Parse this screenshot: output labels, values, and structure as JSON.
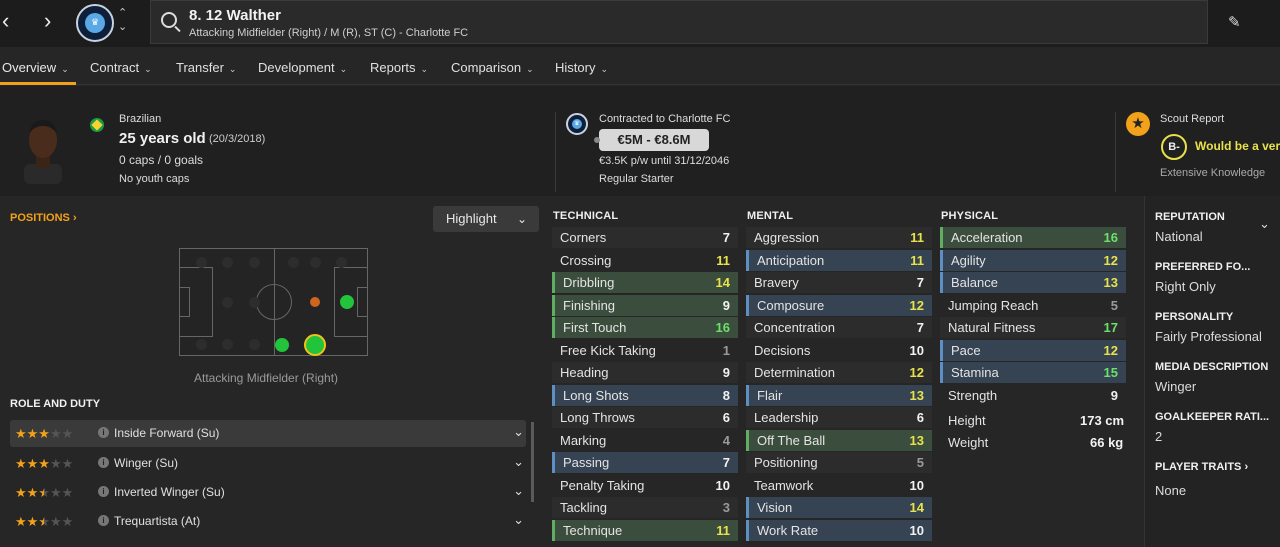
{
  "header": {
    "player_name": "8. 12 Walther",
    "player_sub": "Attacking Midfielder (Right) / M (R), ST (C) - Charlotte FC",
    "nav_back": "‹",
    "nav_forward": "›"
  },
  "tabs": [
    {
      "label": "Overview"
    },
    {
      "label": "Contract"
    },
    {
      "label": "Transfer"
    },
    {
      "label": "Development"
    },
    {
      "label": "Reports"
    },
    {
      "label": "Comparison"
    },
    {
      "label": "History"
    }
  ],
  "profile": {
    "nationality": "Brazilian",
    "age": "25 years old",
    "dob": "(20/3/2018)",
    "caps": "0 caps / 0 goals",
    "youth_caps": "No youth caps"
  },
  "contract": {
    "title": "Contracted to Charlotte FC",
    "value": "€5M - €8.6M",
    "wage": "€3.5K p/w until 31/12/2046",
    "status": "Regular Starter"
  },
  "scout": {
    "title": "Scout Report",
    "grade": "B-",
    "summary": "Would be a ver",
    "knowledge": "Extensive Knowledge"
  },
  "positions": {
    "title": "POSITIONS",
    "highlight_label": "Highlight",
    "caption": "Attacking Midfielder (Right)"
  },
  "roles": {
    "title": "ROLE AND DUTY",
    "items": [
      {
        "name": "Inside Forward (Su)",
        "rating": 3
      },
      {
        "name": "Winger (Su)",
        "rating": 3
      },
      {
        "name": "Inverted Winger (Su)",
        "rating": 2.5
      },
      {
        "name": "Trequartista (At)",
        "rating": 2.5
      }
    ]
  },
  "attributes": {
    "technical": {
      "title": "TECHNICAL",
      "items": [
        {
          "name": "Corners",
          "value": "7",
          "hl": ""
        },
        {
          "name": "Crossing",
          "value": "11",
          "hl": ""
        },
        {
          "name": "Dribbling",
          "value": "14",
          "hl": "g"
        },
        {
          "name": "Finishing",
          "value": "9",
          "hl": "g"
        },
        {
          "name": "First Touch",
          "value": "16",
          "hl": "g"
        },
        {
          "name": "Free Kick Taking",
          "value": "1",
          "hl": ""
        },
        {
          "name": "Heading",
          "value": "9",
          "hl": ""
        },
        {
          "name": "Long Shots",
          "value": "8",
          "hl": "b"
        },
        {
          "name": "Long Throws",
          "value": "6",
          "hl": ""
        },
        {
          "name": "Marking",
          "value": "4",
          "hl": ""
        },
        {
          "name": "Passing",
          "value": "7",
          "hl": "b"
        },
        {
          "name": "Penalty Taking",
          "value": "10",
          "hl": ""
        },
        {
          "name": "Tackling",
          "value": "3",
          "hl": ""
        },
        {
          "name": "Technique",
          "value": "11",
          "hl": "g"
        }
      ]
    },
    "mental": {
      "title": "MENTAL",
      "items": [
        {
          "name": "Aggression",
          "value": "11",
          "hl": ""
        },
        {
          "name": "Anticipation",
          "value": "11",
          "hl": "b"
        },
        {
          "name": "Bravery",
          "value": "7",
          "hl": ""
        },
        {
          "name": "Composure",
          "value": "12",
          "hl": "b"
        },
        {
          "name": "Concentration",
          "value": "7",
          "hl": ""
        },
        {
          "name": "Decisions",
          "value": "10",
          "hl": ""
        },
        {
          "name": "Determination",
          "value": "12",
          "hl": ""
        },
        {
          "name": "Flair",
          "value": "13",
          "hl": "b"
        },
        {
          "name": "Leadership",
          "value": "6",
          "hl": ""
        },
        {
          "name": "Off The Ball",
          "value": "13",
          "hl": "g"
        },
        {
          "name": "Positioning",
          "value": "5",
          "hl": ""
        },
        {
          "name": "Teamwork",
          "value": "10",
          "hl": ""
        },
        {
          "name": "Vision",
          "value": "14",
          "hl": "b"
        },
        {
          "name": "Work Rate",
          "value": "10",
          "hl": "b"
        }
      ]
    },
    "physical": {
      "title": "PHYSICAL",
      "items": [
        {
          "name": "Acceleration",
          "value": "16",
          "hl": "g"
        },
        {
          "name": "Agility",
          "value": "12",
          "hl": "b"
        },
        {
          "name": "Balance",
          "value": "13",
          "hl": "b"
        },
        {
          "name": "Jumping Reach",
          "value": "5",
          "hl": ""
        },
        {
          "name": "Natural Fitness",
          "value": "17",
          "hl": ""
        },
        {
          "name": "Pace",
          "value": "12",
          "hl": "b"
        },
        {
          "name": "Stamina",
          "value": "15",
          "hl": "b"
        },
        {
          "name": "Strength",
          "value": "9",
          "hl": ""
        }
      ],
      "height_label": "Height",
      "height_value": "173 cm",
      "weight_label": "Weight",
      "weight_value": "66 kg"
    }
  },
  "sidebar": {
    "reputation_title": "REPUTATION",
    "reputation_value": "National",
    "foot_title": "PREFERRED FO...",
    "foot_value": "Right Only",
    "personality_title": "PERSONALITY",
    "personality_value": "Fairly Professional",
    "media_title": "MEDIA DESCRIPTION",
    "media_value": "Winger",
    "gk_title": "GOALKEEPER RATI...",
    "gk_value": "2",
    "traits_title": "PLAYER TRAITS",
    "traits_value": "None"
  },
  "colors": {
    "accent": "#f2a21a",
    "good": "#6be06b",
    "high": "#e9e24a"
  }
}
